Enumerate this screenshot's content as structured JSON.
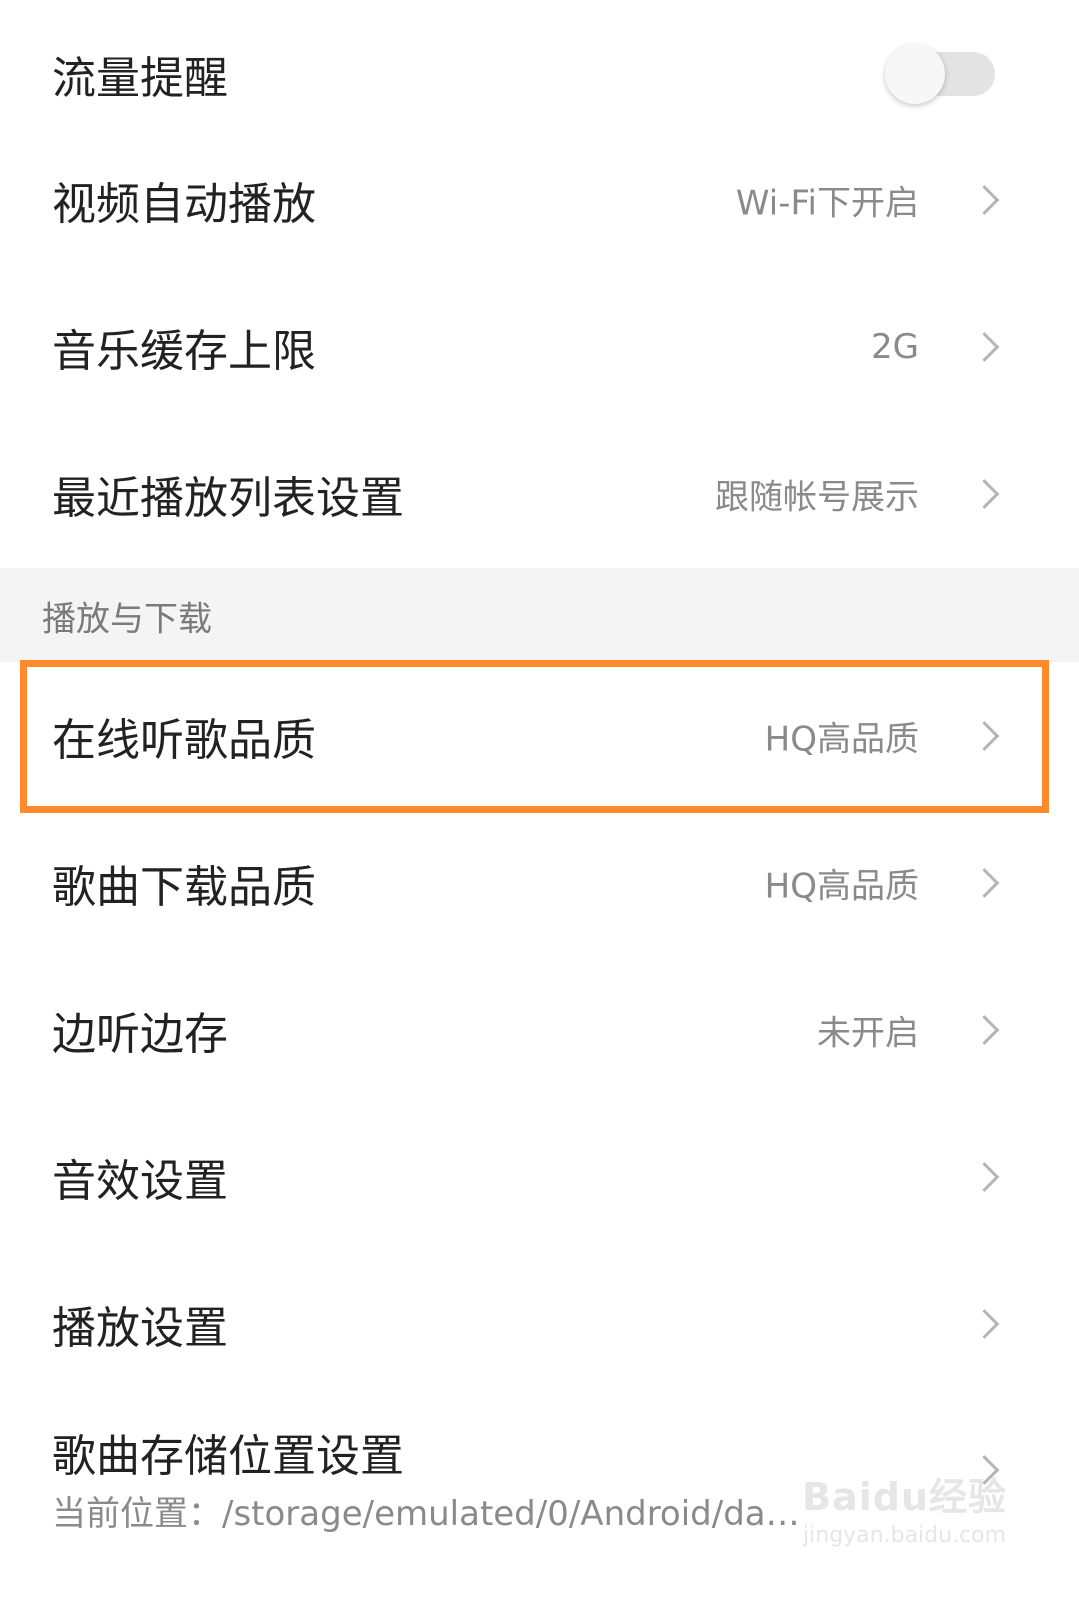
{
  "rows": [
    {
      "label": "流量提醒",
      "type": "toggle",
      "toggle_on": false
    },
    {
      "label": "视频自动播放",
      "value": "Wi-Fi下开启"
    },
    {
      "label": "音乐缓存上限",
      "value": "2G"
    },
    {
      "label": "最近播放列表设置",
      "value": "跟随帐号展示"
    }
  ],
  "section": {
    "title": "播放与下载"
  },
  "section_rows": [
    {
      "label": "在线听歌品质",
      "value": "HQ高品质"
    },
    {
      "label": "歌曲下载品质",
      "value": "HQ高品质"
    },
    {
      "label": "边听边存",
      "value": "未开启"
    },
    {
      "label": "音效设置",
      "value": ""
    },
    {
      "label": "播放设置",
      "value": ""
    }
  ],
  "storage_row": {
    "label": "歌曲存储位置设置",
    "subtitle": "当前位置：/storage/emulated/0/Android/dat…"
  },
  "watermark": {
    "brand": "Baidu经验",
    "url": "jingyan.baidu.com"
  },
  "colors": {
    "highlight": "#ff8a2b",
    "section_bg": "#f4f4f4",
    "label": "#222222",
    "value": "#8a8a8a"
  }
}
